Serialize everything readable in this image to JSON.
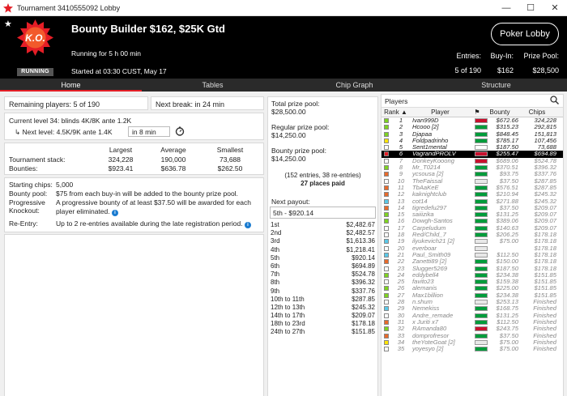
{
  "window": {
    "title": "Tournament 3410555092 Lobby"
  },
  "header": {
    "name": "Bounty Builder $162, $25K Gtd",
    "running_for": "Running for 5 h 00 min",
    "started": "Started at 03:30 CUST, May 17",
    "badge_text": "K.O.",
    "status": "RUNNING",
    "lobby_button": "Poker Lobby",
    "entries_label": "Entries:",
    "entries_value": "5 of 190",
    "buyin_label": "Buy-In:",
    "buyin_value": "$162",
    "prizepool_label": "Prize Pool:",
    "prizepool_value": "$28,500"
  },
  "tabs": [
    "Home",
    "Tables",
    "Chip Graph",
    "Structure"
  ],
  "status": {
    "remaining": "Remaining players: 5 of 190",
    "next_break": "Next break: in 24 min"
  },
  "levels": {
    "current_label": "Current level 34:",
    "current_value": "blinds 4K/8K ante 1.2K",
    "next_label": "Next level:",
    "next_value": "4.5K/9K ante 1.4K",
    "next_in": "in 8 min"
  },
  "stacks": {
    "largest_label": "Largest",
    "average_label": "Average",
    "smallest_label": "Smallest",
    "stack_label": "Tournament stack:",
    "bounties_label": "Bounties:",
    "stack_largest": "324,228",
    "stack_average": "190,000",
    "stack_smallest": "73,688",
    "bounty_largest": "$923.41",
    "bounty_average": "$636.78",
    "bounty_smallest": "$262.50"
  },
  "info": {
    "starting_chips_label": "Starting chips:",
    "starting_chips": "5,000",
    "bounty_pool_label": "Bounty pool:",
    "bounty_pool": "$75 from each buy-in will be added to the bounty prize pool.",
    "progressive_label": "Progressive Knockout:",
    "progressive": "A progressive bounty of at least $37.50 will be awarded for each player eliminated.",
    "reentry_label": "Re-Entry:",
    "reentry": "Up to 2 re-entries available during the late registration period."
  },
  "prizepool": {
    "total_label": "Total prize pool:",
    "total": "$28,500.00",
    "regular_label": "Regular prize pool:",
    "regular": "$14,250.00",
    "bounty_label": "Bounty prize pool:",
    "bounty": "$14,250.00",
    "entries_note": "(152 entries, 38 re-entries)",
    "places_paid": "27 places paid",
    "next_payout_label": "Next payout:",
    "next_payout": "5th - $920.14"
  },
  "payouts": [
    {
      "place": "1st",
      "amount": "$2,482.67"
    },
    {
      "place": "2nd",
      "amount": "$2,482.57"
    },
    {
      "place": "3rd",
      "amount": "$1,613.36"
    },
    {
      "place": "4th",
      "amount": "$1,218.41"
    },
    {
      "place": "5th",
      "amount": "$920.14"
    },
    {
      "place": "6th",
      "amount": "$694.89"
    },
    {
      "place": "7th",
      "amount": "$524.78"
    },
    {
      "place": "8th",
      "amount": "$396.32"
    },
    {
      "place": "9th",
      "amount": "$337.76"
    },
    {
      "place": "10th to 11th",
      "amount": "$287.85"
    },
    {
      "place": "12th to 13th",
      "amount": "$245.32"
    },
    {
      "place": "14th to 17th",
      "amount": "$209.07"
    },
    {
      "place": "18th to 23rd",
      "amount": "$178.18"
    },
    {
      "place": "24th to 27th",
      "amount": "$151.85"
    }
  ],
  "players": {
    "title": "Players",
    "columns": {
      "rank": "Rank",
      "player": "Player",
      "bounty": "Bounty",
      "chips": "Chips"
    },
    "rows": [
      {
        "rank": "1",
        "name": "Ivan999D",
        "bounty": "$672.66",
        "chips": "324,228",
        "sq": "#7ed321",
        "flag": "#c8102e",
        "status": "active"
      },
      {
        "rank": "2",
        "name": "Hcooo [2]",
        "bounty": "$315.23",
        "chips": "292,815",
        "sq": "#7ed321",
        "flag": "#009c3b",
        "status": "active"
      },
      {
        "rank": "3",
        "name": "Djapaa",
        "bounty": "$848.45",
        "chips": "151,813",
        "sq": "#7ed321",
        "flag": "#009c3b",
        "status": "active"
      },
      {
        "rank": "4",
        "name": "Foldpadrinho",
        "bounty": "$785.17",
        "chips": "107,456",
        "sq": "#ffe400",
        "flag": "#009c3b",
        "status": "active"
      },
      {
        "rank": "5",
        "name": "Sent1mental",
        "bounty": "$187.50",
        "chips": "73,688",
        "sq": "#ffffff",
        "flag": "#ffffff",
        "status": "active"
      },
      {
        "rank": "6",
        "name": "VagrandPROLV",
        "bounty": "$255.47",
        "chips": "$694.89",
        "sq": "#e41e26",
        "flag": "#c8102e",
        "status": "highlight"
      },
      {
        "rank": "7",
        "name": "DonkeyKooong",
        "bounty": "$689.06",
        "chips": "$524.78",
        "sq": "#ffffff",
        "flag": "#c8102e",
        "status": "out"
      },
      {
        "rank": "8",
        "name": "Mr_T0214",
        "bounty": "$370.51",
        "chips": "$396.32",
        "sq": "#7ed321",
        "flag": "#009c3b",
        "status": "out"
      },
      {
        "rank": "9",
        "name": "ycsousa [2]",
        "bounty": "$93.75",
        "chips": "$337.76",
        "sq": "#e86a2b",
        "flag": "#009c3b",
        "status": "out"
      },
      {
        "rank": "10",
        "name": "TheFaissal",
        "bounty": "$37.50",
        "chips": "$287.85",
        "sq": "#ffffff",
        "flag": "#e8e8e8",
        "status": "out"
      },
      {
        "rank": "11",
        "name": "TbAaKeE",
        "bounty": "$576.51",
        "chips": "$287.85",
        "sq": "#e86a2b",
        "flag": "#009c3b",
        "status": "out"
      },
      {
        "rank": "12",
        "name": "kaknightclub",
        "bounty": "$210.94",
        "chips": "$245.32",
        "sq": "#e86a2b",
        "flag": "#009c3b",
        "status": "out"
      },
      {
        "rank": "13",
        "name": "cot14",
        "bounty": "$271.88",
        "chips": "$245.32",
        "sq": "#5ac8e8",
        "flag": "#009c3b",
        "status": "out"
      },
      {
        "rank": "14",
        "name": "tigredefu297",
        "bounty": "$37.50",
        "chips": "$209.07",
        "sq": "#e86a2b",
        "flag": "#009c3b",
        "status": "out"
      },
      {
        "rank": "15",
        "name": "saiiizika",
        "bounty": "$131.25",
        "chips": "$209.07",
        "sq": "#7ed321",
        "flag": "#009c3b",
        "status": "out"
      },
      {
        "rank": "16",
        "name": "Dowgh-Santos",
        "bounty": "$389.06",
        "chips": "$209.07",
        "sq": "#7ed321",
        "flag": "#009c3b",
        "status": "out"
      },
      {
        "rank": "17",
        "name": "Carpeludum",
        "bounty": "$140.63",
        "chips": "$209.07",
        "sq": "#ffffff",
        "flag": "#009c3b",
        "status": "out"
      },
      {
        "rank": "18",
        "name": "Red/Child_7",
        "bounty": "$206.25",
        "chips": "$178.18",
        "sq": "#ffffff",
        "flag": "#009c3b",
        "status": "out"
      },
      {
        "rank": "19",
        "name": "ilyukevich21 [2]",
        "bounty": "$75.00",
        "chips": "$178.18",
        "sq": "#5ac8e8",
        "flag": "#e8e8e8",
        "status": "out"
      },
      {
        "rank": "20",
        "name": "everboar",
        "bounty": "",
        "chips": "$178.18",
        "sq": "#ffffff",
        "flag": "#e8e8e8",
        "status": "out"
      },
      {
        "rank": "21",
        "name": "Paul_Smith09",
        "bounty": "$112.50",
        "chips": "$178.18",
        "sq": "#5ac8e8",
        "flag": "#e8e8e8",
        "status": "out"
      },
      {
        "rank": "22",
        "name": "Zanetti89 [2]",
        "bounty": "$150.00",
        "chips": "$178.18",
        "sq": "#e86a2b",
        "flag": "#009c3b",
        "status": "out"
      },
      {
        "rank": "23",
        "name": "Slugger5269",
        "bounty": "$187.50",
        "chips": "$178.18",
        "sq": "#ffffff",
        "flag": "#009c3b",
        "status": "out"
      },
      {
        "rank": "24",
        "name": "eddybell4",
        "bounty": "$234.38",
        "chips": "$151.85",
        "sq": "#7ed321",
        "flag": "#009c3b",
        "status": "out"
      },
      {
        "rank": "25",
        "name": "favito23",
        "bounty": "$159.38",
        "chips": "$151.85",
        "sq": "#ffffff",
        "flag": "#009c3b",
        "status": "out"
      },
      {
        "rank": "26",
        "name": "alemanis",
        "bounty": "$225.00",
        "chips": "$151.85",
        "sq": "#7ed321",
        "flag": "#009c3b",
        "status": "out"
      },
      {
        "rank": "27",
        "name": "Max1billion",
        "bounty": "$234.38",
        "chips": "$151.85",
        "sq": "#7ed321",
        "flag": "#009c3b",
        "status": "out"
      },
      {
        "rank": "28",
        "name": "n.shum",
        "bounty": "$253.13",
        "chips": "Finished",
        "sq": "#ffffff",
        "flag": "#e8e8e8",
        "status": "out"
      },
      {
        "rank": "29",
        "name": "Nemekiss",
        "bounty": "$168.75",
        "chips": "Finished",
        "sq": "#5ac8e8",
        "flag": "#009c3b",
        "status": "out"
      },
      {
        "rank": "30",
        "name": "Andre_remade",
        "bounty": "$131.25",
        "chips": "Finished",
        "sq": "#ffffff",
        "flag": "#009c3b",
        "status": "out"
      },
      {
        "rank": "31",
        "name": "x Juriti x7",
        "bounty": "$112.50",
        "chips": "Finished",
        "sq": "#e86a2b",
        "flag": "#009c3b",
        "status": "out"
      },
      {
        "rank": "32",
        "name": "RAmanda80",
        "bounty": "$243.75",
        "chips": "Finished",
        "sq": "#7ed321",
        "flag": "#c8102e",
        "status": "out"
      },
      {
        "rank": "33",
        "name": "domprofresor",
        "bounty": "$37.50",
        "chips": "Finished",
        "sq": "#e86a2b",
        "flag": "#009c3b",
        "status": "out"
      },
      {
        "rank": "34",
        "name": "theYoteGoat [2]",
        "bounty": "$75.00",
        "chips": "Finished",
        "sq": "#ffe400",
        "flag": "#e8e8e8",
        "status": "out"
      },
      {
        "rank": "35",
        "name": "yoyesyo [2]",
        "bounty": "$75.00",
        "chips": "Finished",
        "sq": "#ffffff",
        "flag": "#009c3b",
        "status": "out"
      }
    ]
  },
  "colors": {
    "accent": "#e41e26",
    "header_bg": "#000000",
    "tab_bg": "#2a2a2a",
    "info": "#1a7bd0"
  }
}
